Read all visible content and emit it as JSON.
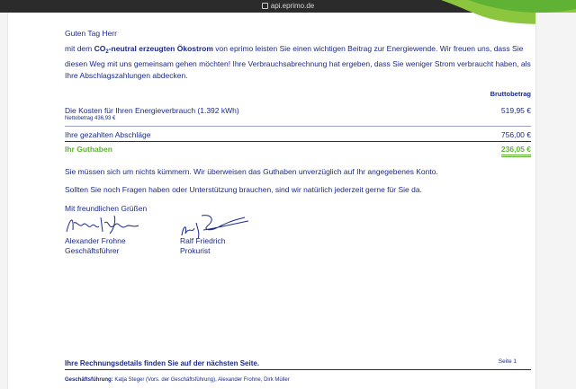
{
  "browser": {
    "url": "api.eprimo.de"
  },
  "letter": {
    "greeting": "Guten Tag Herr",
    "intro_prefix": "mit dem ",
    "intro_co2": "CO",
    "intro_sub": "2",
    "intro_bold": "-neutral erzeugten Ökostrom",
    "intro_rest": " von eprimo leisten Sie einen wichtigen Beitrag zur Energiewende. Wir freuen uns, dass Sie diesen Weg mit uns gemeinsam gehen möchten! Ihre Verbrauchsabrechnung hat ergeben, dass Sie weniger Strom verbraucht haben, als Ihre Abschlagszahlungen abdecken.",
    "column_header": "Bruttobetrag",
    "rows": [
      {
        "label": "Die Kosten für Ihren Energieverbrauch (1.392 kWh)",
        "amount": "519,95 €",
        "note": "Nettobetrag 436,93 €"
      },
      {
        "label": "Ihre gezahlten Abschläge",
        "amount": "756,00 €"
      },
      {
        "label": "Ihr Guthaben",
        "amount": "236,05 €"
      }
    ],
    "para_refund": "Sie müssen sich um nichts kümmern. Wir überweisen das Guthaben unverzüglich auf Ihr angegebenes Konto.",
    "para_questions": "Sollten Sie noch Fragen haben oder Unterstützung brauchen, sind wir natürlich jederzeit gerne für Sie da.",
    "closing": "Mit freundlichen Grüßen",
    "signatories": [
      {
        "name": "Alexander Frohne",
        "title": "Geschäftsführer"
      },
      {
        "name": "Ralf Friedrich",
        "title": "Prokurist"
      }
    ],
    "footer_title": "Ihre Rechnungsdetails finden Sie auf der nächsten Seite.",
    "page_number": "Seite 1",
    "management_label": "Geschäftsführung:",
    "management_names": " Katja Steger (Vors. der Geschäftsführung), Alexander Frohne, Dirk Müller"
  },
  "colors": {
    "text": "#1b2a8a",
    "accent_green": "#5fb233",
    "browser_bar": "#2b2b2b"
  }
}
